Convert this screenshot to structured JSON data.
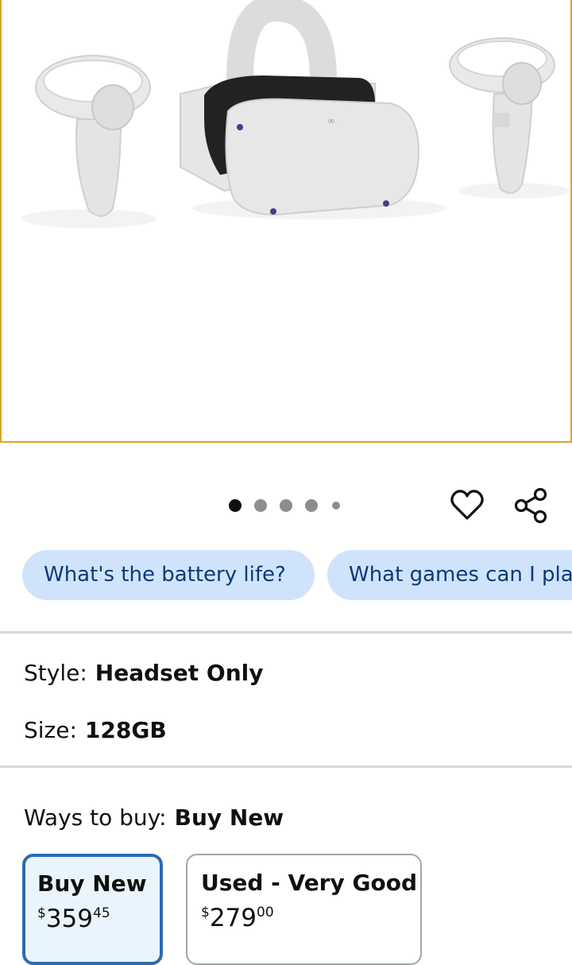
{
  "product_image": {
    "alt_icon": "vr-headset-with-controllers-photo"
  },
  "carousel": {
    "dot_count": 5,
    "active_index": 0
  },
  "actions": {
    "wishlist_icon": "heart-icon",
    "share_icon": "share-icon"
  },
  "questions": {
    "chips": [
      "What's the battery life?",
      "What games can I play?"
    ]
  },
  "variations": {
    "style_label": "Style:",
    "style_value": "Headset Only",
    "size_label": "Size:",
    "size_value": "128GB"
  },
  "buying": {
    "label": "Ways to buy:",
    "selected": "Buy New",
    "options": [
      {
        "title": "Buy New",
        "currency": "$",
        "whole": "359",
        "fraction": "45"
      },
      {
        "title": "Used - Very Good",
        "currency": "$",
        "whole": "279",
        "fraction": "00"
      }
    ]
  },
  "colors": {
    "frame_border": "#d4a72c",
    "chip_bg": "#cfe4fb",
    "chip_text": "#0b3a77",
    "selected_border": "#2a6bb3"
  }
}
